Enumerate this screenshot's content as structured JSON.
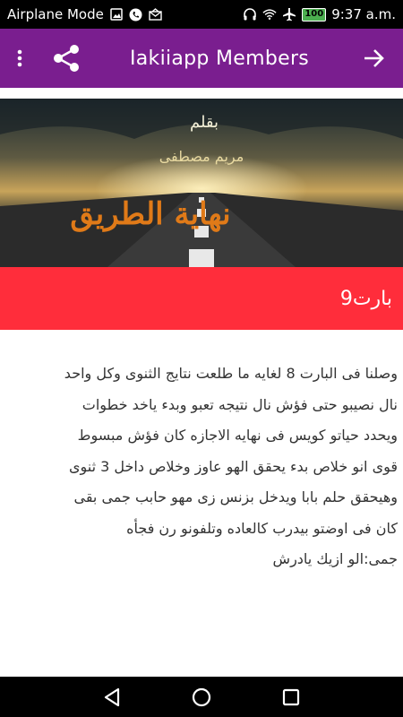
{
  "status_bar": {
    "mode": "Airplane Mode",
    "battery": "100",
    "time": "9:37 a.m."
  },
  "app_bar": {
    "title": "Iakiiapp Members",
    "menu_icon": "more-vert-icon",
    "share_icon": "share-icon",
    "forward_icon": "arrow-forward-icon",
    "color": "#7a1e8f"
  },
  "cover": {
    "byline_1": "بقلم",
    "byline_2": "مريم مصطفى",
    "title": "نهاية الطريق"
  },
  "chapter": {
    "title": "بارت9",
    "color": "#ff2d3b"
  },
  "story": {
    "lines": [
      "وصلنا فى البارت 8 لغايه ما طلعت نتايج الثنوى وكل واحد",
      "نال نصيبو حتى فؤش نال نتيجه تعبو وبدء ياخد خطوات",
      "ويحدد حياتو كويس فى نهايه الاجازه كان فؤش مبسوط",
      "قوى انو خلاص بدء يحقق الهو عاوز وخلاص داخل 3 ثنوى",
      "وهيحقق حلم بابا ويدخل بزنس زى مهو حابب جمى بقى",
      "كان فى اوضتو بيدرب كالعاده وتلفونو رن فجأه",
      "جمى:الو ازيك يادرش"
    ]
  },
  "nav_bar": {
    "back_icon": "back-triangle-icon",
    "home_icon": "home-circle-icon",
    "recents_icon": "recents-square-icon"
  }
}
